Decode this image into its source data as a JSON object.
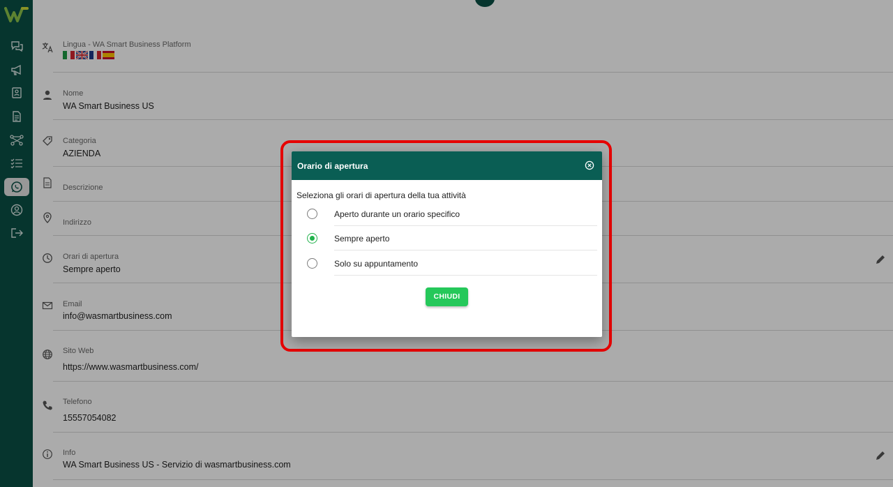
{
  "colors": {
    "sidebar_bg": "#0a4f45",
    "dialog_header_bg": "#0a5e54",
    "accent_green": "#25c85a",
    "highlight_red": "#e60000"
  },
  "sidebar": {
    "logo": "W",
    "items": [
      {
        "icon": "chat-icon"
      },
      {
        "icon": "megaphone-icon"
      },
      {
        "icon": "contacts-icon"
      },
      {
        "icon": "document-icon"
      },
      {
        "icon": "flow-icon"
      },
      {
        "icon": "checklist-icon"
      },
      {
        "icon": "whatsapp-icon",
        "active": true
      },
      {
        "icon": "account-icon"
      },
      {
        "icon": "logout-icon"
      }
    ]
  },
  "profile": {
    "language": {
      "label": "Lingua - WA Smart Business Platform",
      "flags": [
        "it",
        "gb",
        "fr",
        "es"
      ]
    },
    "name": {
      "label": "Nome",
      "value": "WA Smart Business US"
    },
    "category": {
      "label": "Categoria",
      "value": "AZIENDA"
    },
    "description": {
      "label": "Descrizione",
      "value": ""
    },
    "address": {
      "label": "Indirizzo",
      "value": ""
    },
    "hours": {
      "label": "Orari di apertura",
      "value": "Sempre aperto"
    },
    "email": {
      "label": "Email",
      "value": "info@wasmartbusiness.com"
    },
    "website": {
      "label": "Sito Web",
      "value": "https://www.wasmartbusiness.com/"
    },
    "phone": {
      "label": "Telefono",
      "value": "15557054082"
    },
    "info": {
      "label": "Info",
      "value": "WA Smart Business US - Servizio di wasmartbusiness.com"
    }
  },
  "dialog": {
    "title": "Orario di apertura",
    "prompt": "Seleziona gli orari di apertura della tua attività",
    "options": [
      {
        "label": "Aperto durante un orario specifico",
        "selected": false
      },
      {
        "label": "Sempre aperto",
        "selected": true
      },
      {
        "label": "Solo su appuntamento",
        "selected": false
      }
    ],
    "close_button": "CHIUDI"
  }
}
